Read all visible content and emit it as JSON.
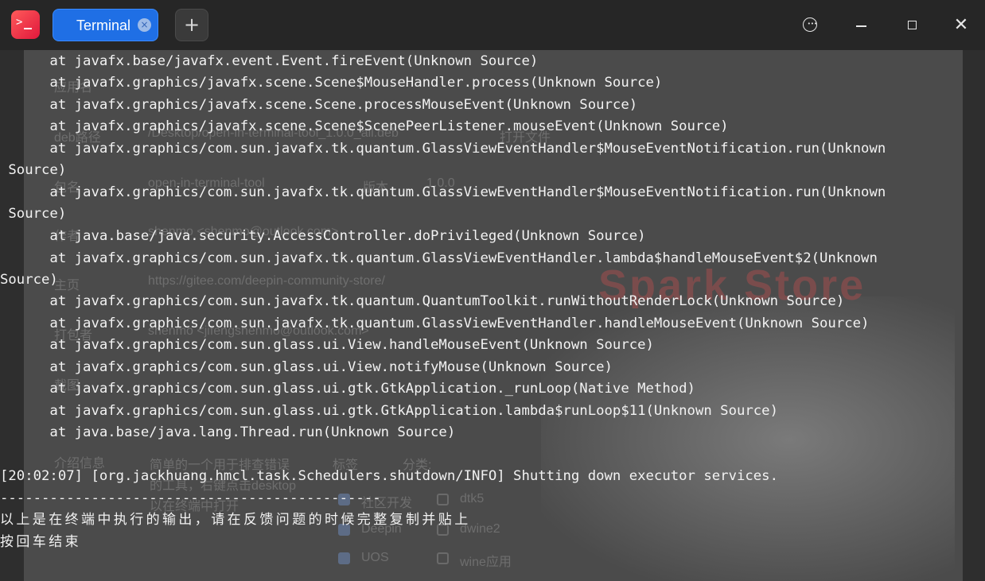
{
  "window": {
    "tab_label": "Terminal",
    "tab_close_glyph": "×",
    "add_tab_glyph": "+",
    "close_glyph": "✕",
    "menu_dots": "•••",
    "accent": "#1f6fe5"
  },
  "icons": [
    "terminal-app-icon",
    "tab-close-icon",
    "plus-icon",
    "more-menu-icon",
    "minimize-icon",
    "maximize-icon",
    "close-icon"
  ],
  "terminal": {
    "lines": [
      "      at javafx.base/javafx.event.Event.fireEvent(Unknown Source)",
      "      at javafx.graphics/javafx.scene.Scene$MouseHandler.process(Unknown Source)",
      "      at javafx.graphics/javafx.scene.Scene.processMouseEvent(Unknown Source)",
      "      at javafx.graphics/javafx.scene.Scene$ScenePeerListener.mouseEvent(Unknown Source)",
      "      at javafx.graphics/com.sun.javafx.tk.quantum.GlassViewEventHandler$MouseEventNotification.run(Unknown",
      " Source)",
      "      at javafx.graphics/com.sun.javafx.tk.quantum.GlassViewEventHandler$MouseEventNotification.run(Unknown",
      " Source)",
      "      at java.base/java.security.AccessController.doPrivileged(Unknown Source)",
      "      at javafx.graphics/com.sun.javafx.tk.quantum.GlassViewEventHandler.lambda$handleMouseEvent$2(Unknown",
      "Source)",
      "      at javafx.graphics/com.sun.javafx.tk.quantum.QuantumToolkit.runWithoutRenderLock(Unknown Source)",
      "      at javafx.graphics/com.sun.javafx.tk.quantum.GlassViewEventHandler.handleMouseEvent(Unknown Source)",
      "      at javafx.graphics/com.sun.glass.ui.View.handleMouseEvent(Unknown Source)",
      "      at javafx.graphics/com.sun.glass.ui.View.notifyMouse(Unknown Source)",
      "      at javafx.graphics/com.sun.glass.ui.gtk.GtkApplication._runLoop(Native Method)",
      "      at javafx.graphics/com.sun.glass.ui.gtk.GtkApplication.lambda$runLoop$11(Unknown Source)",
      "      at java.base/java.lang.Thread.run(Unknown Source)",
      "",
      "[20:02:07] [org.jackhuang.hmcl.task.Schedulers.shutdown/INFO] Shutting down executor services.",
      "----------------------------------------------",
      "以上是在终端中执行的输出，请在反馈问题的时候完整复制并贴上",
      "按回车结束"
    ]
  },
  "background_window": {
    "labels": [
      "应用名",
      "deb路径",
      "包名",
      "版本",
      "作者",
      "主页",
      "打包者",
      "截图",
      "介绍信息",
      "标签",
      "分类:",
      "打开文件",
      "Spark Store"
    ],
    "values": [
      "/Desktop/open-in-terminal-tool_1.0.0_all.deb",
      "open-in-terminal-tool",
      "1.0.0",
      "shenmo <shenmo@outlook.com>",
      "https://gitee.com/deepin-community-store/",
      "shenmo <jifengshenmo@outlook.com>",
      "简单的一个用于排查错误的工具，右键点击desktop以在终端中打开"
    ],
    "checkboxes": [
      {
        "label": "社区开发",
        "checked": true
      },
      {
        "label": "dtk5",
        "checked": false
      },
      {
        "label": "Deepin",
        "checked": true
      },
      {
        "label": "dwine2",
        "checked": false
      },
      {
        "label": "UOS",
        "checked": true
      },
      {
        "label": "wine应用",
        "checked": false
      }
    ]
  }
}
